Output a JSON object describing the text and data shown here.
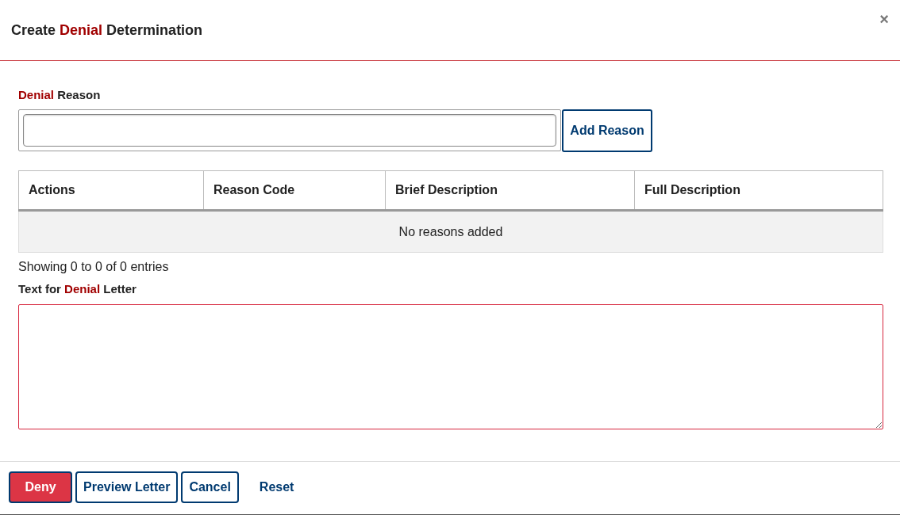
{
  "dialog": {
    "title": [
      {
        "text": "Create",
        "highlight": false
      },
      {
        "text": "Denial",
        "highlight": true
      },
      {
        "text": "Determination",
        "highlight": false
      }
    ],
    "close": "×"
  },
  "reason": {
    "label": [
      {
        "text": "Denial",
        "highlight": true
      },
      {
        "text": "Reason",
        "highlight": false
      }
    ],
    "add_button": "Add Reason"
  },
  "table": {
    "columns": [
      "Actions",
      "Reason Code",
      "Brief Description",
      "Full Description"
    ],
    "empty_message": "No reasons added",
    "info": "Showing 0 to 0 of 0 entries"
  },
  "letter": {
    "label": [
      {
        "text": "Text for",
        "highlight": false
      },
      {
        "text": "Denial",
        "highlight": true
      },
      {
        "text": "Letter",
        "highlight": false
      }
    ],
    "invalid": true
  },
  "buttons": [
    {
      "label": "Deny",
      "kind": "primary"
    },
    {
      "label": "Preview Letter",
      "kind": "outline"
    },
    {
      "label": "Cancel",
      "kind": "outline"
    },
    {
      "label": "Reset",
      "kind": "link"
    }
  ]
}
